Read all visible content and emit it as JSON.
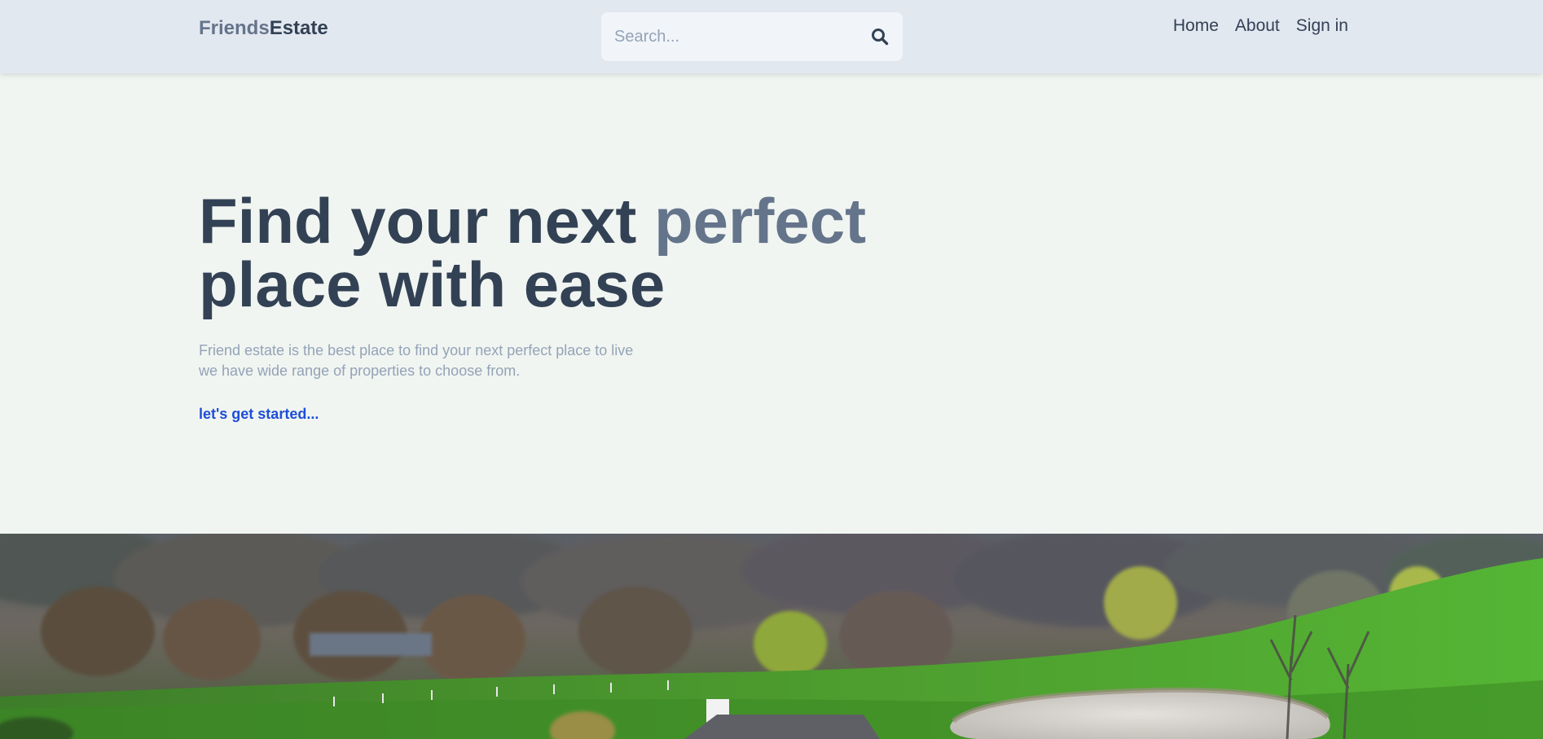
{
  "header": {
    "logo_first": "Friends",
    "logo_second": "Estate",
    "search_placeholder": "Search...",
    "search_icon": "search-icon",
    "nav": {
      "home": "Home",
      "about": "About",
      "sign_in": "Sign in"
    }
  },
  "hero": {
    "title_part1": "Find your next ",
    "title_accent": "perfect",
    "title_part2": "place with ease",
    "description_line1": "Friend estate is the best place to find your next perfect place to live",
    "description_line2": "we have wide range of properties to choose from.",
    "cta": "let's get started..."
  },
  "colors": {
    "header_bg": "#e2e8f0",
    "page_bg": "#f1f5f1",
    "text_dark": "#334155",
    "text_muted": "#64748b",
    "text_light": "#94a3b8",
    "link": "#1d4ed8"
  }
}
